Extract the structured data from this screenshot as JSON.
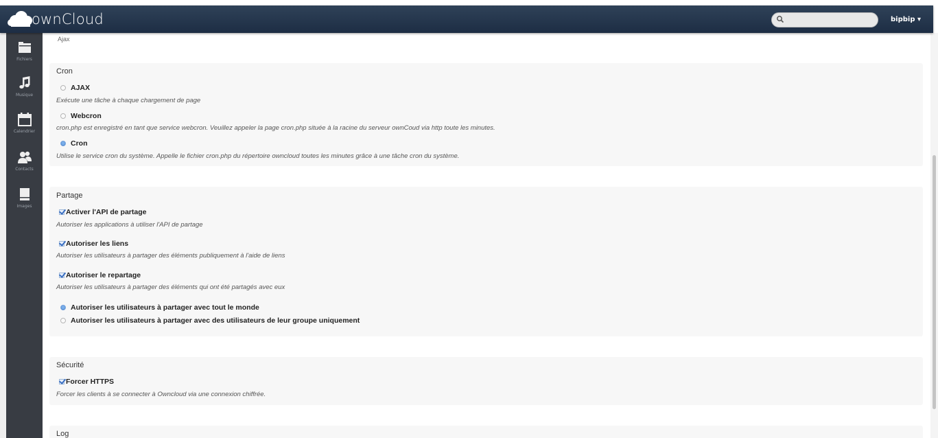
{
  "header": {
    "logo_text": "ownCloud",
    "search_value": "",
    "user_label": "bipbip ▾"
  },
  "sidebar": {
    "items": [
      {
        "label": "Fichiers",
        "icon": "folder-icon"
      },
      {
        "label": "Musique",
        "icon": "music-icon"
      },
      {
        "label": "Calendrier",
        "icon": "calendar-icon"
      },
      {
        "label": "Contacts",
        "icon": "contacts-icon"
      },
      {
        "label": "Images",
        "icon": "images-icon"
      }
    ]
  },
  "partial_top_text": "Ajax",
  "cron": {
    "title": "Cron",
    "options": [
      {
        "label": "AJAX",
        "desc": "Exécute une tâche à chaque chargement de page",
        "selected": false
      },
      {
        "label": "Webcron",
        "desc": "cron.php est enregistré en tant que service webcron. Veuillez appeler la page cron.php située à la racine du serveur ownCoud via http toute les minutes.",
        "selected": false
      },
      {
        "label": "Cron",
        "desc": "Utilise le service cron du système. Appelle le fichier cron.php du répertoire owncloud toutes les minutes grâce à une tâche cron du système.",
        "selected": true
      }
    ]
  },
  "sharing": {
    "title": "Partage",
    "checkboxes": [
      {
        "label": "Activer l'API de partage",
        "desc": "Autoriser les applications à utiliser l'API de partage",
        "checked": true
      },
      {
        "label": "Autoriser les liens",
        "desc": "Autoriser les utilisateurs à partager des éléments publiquement à l'aide de liens",
        "checked": true
      },
      {
        "label": "Autoriser le repartage",
        "desc": "Autoriser les utilisateurs à partager des éléments qui ont été partagés avec eux",
        "checked": true
      }
    ],
    "radios": [
      {
        "label": "Autoriser les utilisateurs à partager avec tout le monde",
        "selected": true
      },
      {
        "label": "Autoriser les utilisateurs à partager avec des utilisateurs de leur groupe uniquement",
        "selected": false
      }
    ]
  },
  "security": {
    "title": "Sécurité",
    "checkbox": {
      "label": "Forcer HTTPS",
      "desc": "Forcer les clients à se connecter à Owncloud via une connexion chiffrée.",
      "checked": true
    }
  },
  "log": {
    "title": "Log"
  },
  "colors": {
    "header_bg": "#1d2d44",
    "sidebar_bg": "#383c43",
    "section_bg": "#f7f7f7",
    "accent": "#4c86d0"
  }
}
